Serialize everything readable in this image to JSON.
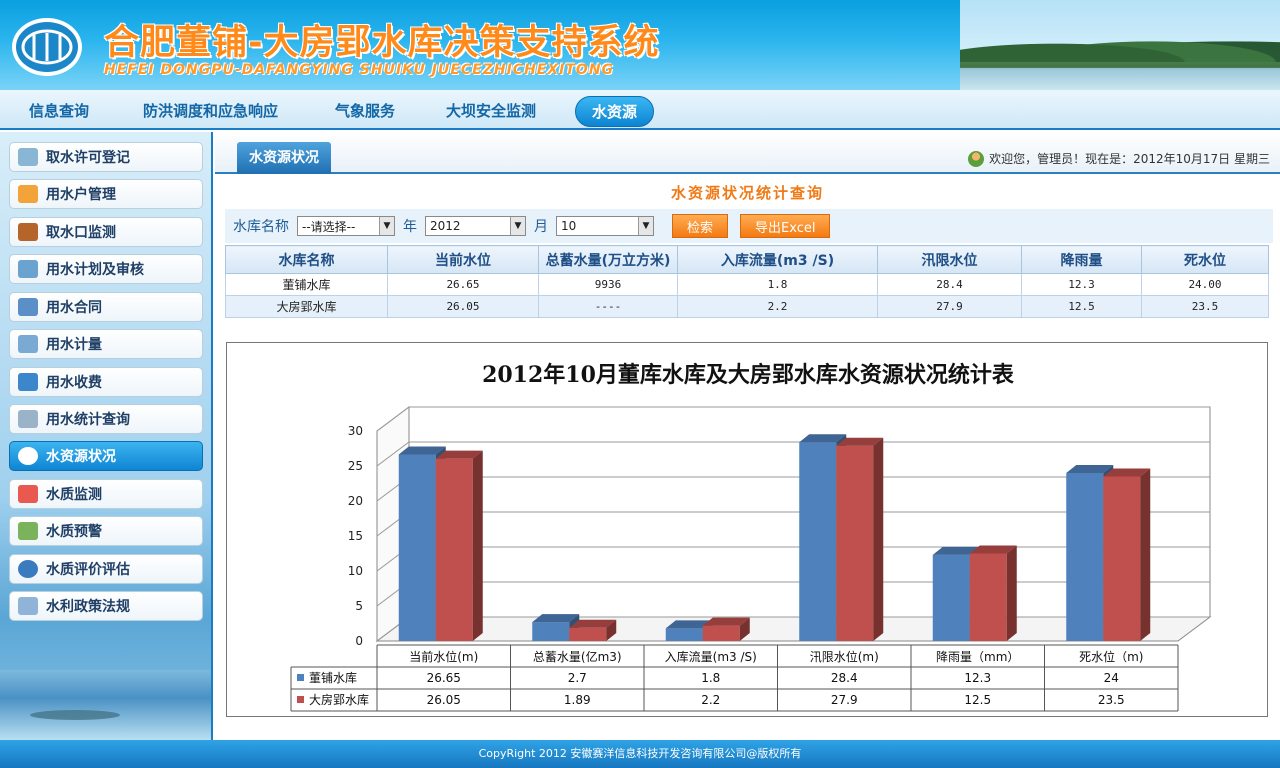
{
  "header": {
    "title_cn": "合肥董铺-大房郢水库决策支持系统",
    "title_en": "HEFEI DONGPU-DAFANGYING SHUIKU JUECEZHICHEXITONG"
  },
  "nav": {
    "items": [
      {
        "label": "信息查询"
      },
      {
        "label": "防洪调度和应急响应"
      },
      {
        "label": "气象服务"
      },
      {
        "label": "大坝安全监测"
      },
      {
        "label": "水资源"
      }
    ]
  },
  "sidebar": {
    "items": [
      {
        "label": "取水许可登记",
        "icon": "folder-icon",
        "color": "#8ab6d6"
      },
      {
        "label": "用水户管理",
        "icon": "users-icon",
        "color": "#f2a33a"
      },
      {
        "label": "取水口监测",
        "icon": "monitor-icon",
        "color": "#b5652a"
      },
      {
        "label": "用水计划及审核",
        "icon": "chart-icon",
        "color": "#6aa3cf"
      },
      {
        "label": "用水合同",
        "icon": "contract-icon",
        "color": "#5b8fc7"
      },
      {
        "label": "用水计量",
        "icon": "meter-icon",
        "color": "#7aa9d3"
      },
      {
        "label": "用水收费",
        "icon": "fee-icon",
        "color": "#3c86cc"
      },
      {
        "label": "用水统计查询",
        "icon": "edit-icon",
        "color": "#9bb3c8"
      },
      {
        "label": "水资源状况",
        "icon": "refresh-icon",
        "color": "#ffffff"
      },
      {
        "label": "水质监测",
        "icon": "grid-icon",
        "color": "#e85a4f"
      },
      {
        "label": "水质预警",
        "icon": "alert-icon",
        "color": "#7bb35d"
      },
      {
        "label": "水质评价评估",
        "icon": "evaluate-icon",
        "color": "#3a7bc0"
      },
      {
        "label": "水利政策法规",
        "icon": "law-icon",
        "color": "#8fb4d8"
      }
    ]
  },
  "main": {
    "tab_label": "水资源状况",
    "welcome": "欢迎您，管理员！现在是：2012年10月17日 星期三",
    "section_title": "水资源状况统计查询",
    "search": {
      "reservoir_label": "水库名称",
      "reservoir_value": "--请选择--",
      "year_label": "年",
      "year_value": "2012",
      "month_label": "月",
      "month_value": "10",
      "search_button": "检索",
      "export_button": "导出Excel"
    },
    "table": {
      "headers": [
        "水库名称",
        "当前水位",
        "总蓄水量(万立方米)",
        "入库流量(m3 /S)",
        "汛限水位",
        "降雨量",
        "死水位"
      ],
      "rows": [
        [
          "董铺水库",
          "26.65",
          "9936",
          "1.8",
          "28.4",
          "12.3",
          "24.00"
        ],
        [
          "大房郢水库",
          "26.05",
          "----",
          "2.2",
          "27.9",
          "12.5",
          "23.5"
        ]
      ]
    }
  },
  "chart_data": {
    "type": "bar",
    "title": "2012年10月董库水库及大房郢水库水资源状况统计表",
    "categories": [
      "当前水位(m)",
      "总蓄水量(亿m3)",
      "入库流量(m3 /S)",
      "汛限水位(m)",
      "降雨量（mm）",
      "死水位（m)"
    ],
    "ylim": [
      0,
      30
    ],
    "yticks": [
      0,
      5,
      10,
      15,
      20,
      25,
      30
    ],
    "grid": true,
    "three_d": true,
    "series": [
      {
        "name": "董铺水库",
        "values": [
          26.65,
          2.7,
          1.8,
          28.4,
          12.3,
          24
        ],
        "labels": [
          "26.65",
          "2.7",
          "1.8",
          "28.4",
          "12.3",
          "24"
        ],
        "color": "#4f81bd"
      },
      {
        "name": "大房郢水库",
        "values": [
          26.05,
          1.89,
          2.2,
          27.9,
          12.5,
          23.5
        ],
        "labels": [
          "26.05",
          "1.89",
          "2.2",
          "27.9",
          "12.5",
          "23.5"
        ],
        "color": "#c0504d"
      }
    ]
  },
  "footer": {
    "text": "CopyRight 2012 安徽赛洋信息科技开发咨询有限公司@版权所有"
  }
}
